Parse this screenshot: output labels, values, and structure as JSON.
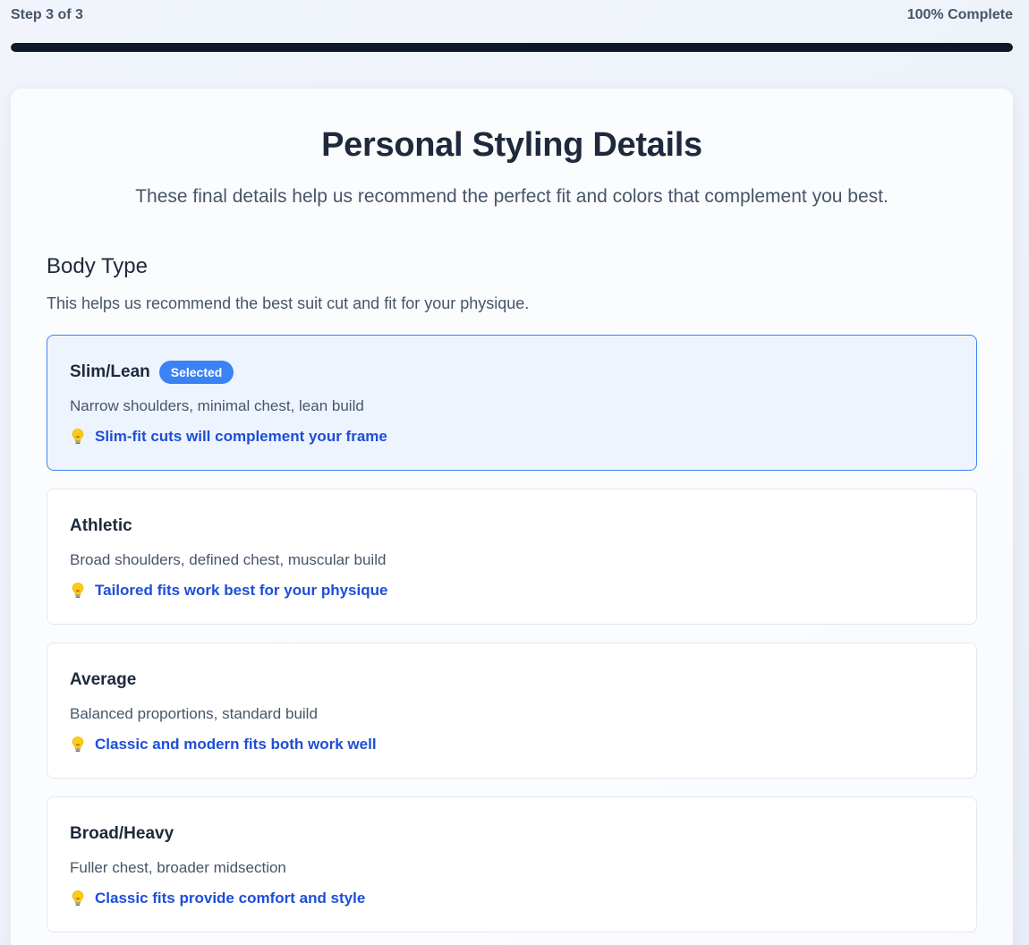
{
  "progress": {
    "step_label": "Step 3 of 3",
    "percent_label": "100% Complete",
    "fraction": 1.0,
    "fill_color": "#0f172a"
  },
  "page": {
    "title": "Personal Styling Details",
    "subtitle": "These final details help us recommend the perfect fit and colors that complement you best."
  },
  "body_type": {
    "title": "Body Type",
    "description": "This helps us recommend the best suit cut and fit for your physique.",
    "selected_badge": "Selected",
    "tip_icon": "lightbulb-icon",
    "options": [
      {
        "title": "Slim/Lean",
        "description": "Narrow shoulders, minimal chest, lean build",
        "tip": "Slim-fit cuts will complement your frame",
        "selected": true
      },
      {
        "title": "Athletic",
        "description": "Broad shoulders, defined chest, muscular build",
        "tip": "Tailored fits work best for your physique",
        "selected": false
      },
      {
        "title": "Average",
        "description": "Balanced proportions, standard build",
        "tip": "Classic and modern fits both work well",
        "selected": false
      },
      {
        "title": "Broad/Heavy",
        "description": "Fuller chest, broader midsection",
        "tip": "Classic fits provide comfort and style",
        "selected": false
      }
    ]
  },
  "colors": {
    "accent": "#3b82f6",
    "tip_text": "#1d4ed8",
    "selected_bg": "#eef4fd"
  }
}
